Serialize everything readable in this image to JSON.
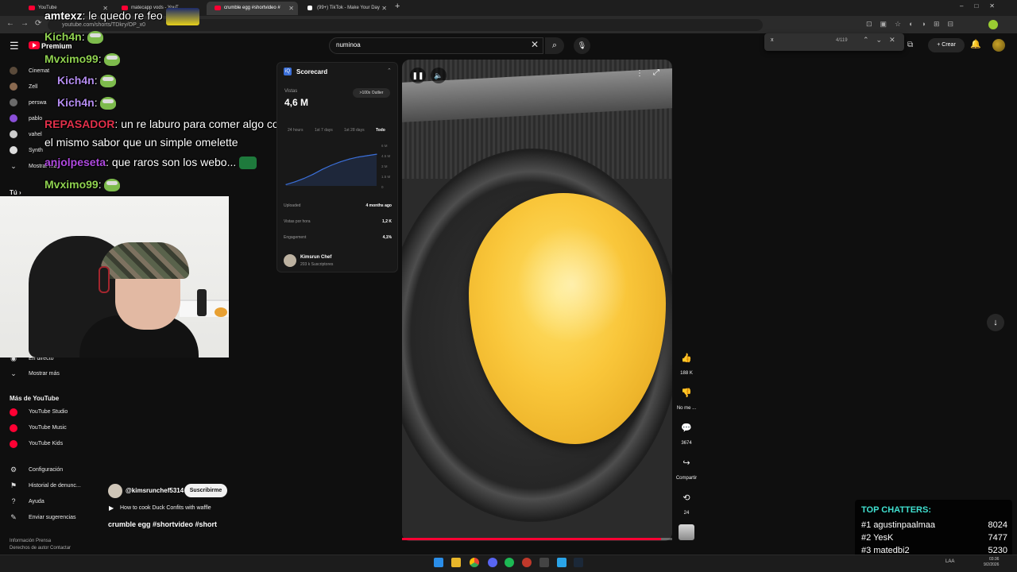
{
  "browser": {
    "tabs": [
      {
        "title": "YouTube",
        "active": false
      },
      {
        "title": "matecapp vods - YouT",
        "active": false
      },
      {
        "title": "crumble egg #shortvideo #",
        "active": true
      },
      {
        "title": "(99+) TikTok - Make Your Day",
        "active": false
      }
    ],
    "url": "youtube.com/shorts/TDkry/OP_x0",
    "find": {
      "query": "x",
      "count": "4/119"
    }
  },
  "header": {
    "logo_text": "Premium",
    "search_value": "numinoa",
    "create_label": "Crear"
  },
  "sidebar": {
    "subscriptions": [
      {
        "label": "Cinemat",
        "color": "#5a4a3a"
      },
      {
        "label": "Zell",
        "color": "#8a6a50"
      },
      {
        "label": "perswa",
        "color": "#6a6a6a"
      },
      {
        "label": "pablo",
        "color": "#8a4fd8"
      },
      {
        "label": "vahel",
        "color": "#cccccc"
      },
      {
        "label": "Synth",
        "color": "#dddddd"
      }
    ],
    "show_more_top": "Mostrar más",
    "you_label": "Tú",
    "live_label": "En directo",
    "show_more": "Mostrar más",
    "more_heading": "Más de YouTube",
    "more_items": [
      {
        "label": "YouTube Studio"
      },
      {
        "label": "YouTube Music"
      },
      {
        "label": "YouTube Kids"
      }
    ],
    "settings_items": [
      {
        "label": "Configuración"
      },
      {
        "label": "Historial de denunc..."
      },
      {
        "label": "Ayuda"
      },
      {
        "label": "Enviar sugerencias"
      }
    ],
    "footer_1": "Información  Prensa",
    "footer_2": "Derechos de autor  Contactar"
  },
  "chat": [
    {
      "name": "amtexz",
      "color": "#ffffff",
      "text": "le quedo re feo",
      "emote": "car"
    },
    {
      "name": "Kich4n",
      "color": "#8fd14f",
      "text": "",
      "emote": "frog"
    },
    {
      "name": "Mvximo99",
      "color": "#8fd14f",
      "text": "",
      "emote": "frog"
    },
    {
      "name": "Kich4n",
      "color": "#b48cf0",
      "text": "",
      "emote": "frog"
    },
    {
      "name": "Kich4n",
      "color": "#b48cf0",
      "text": "",
      "emote": "frog"
    },
    {
      "name": "REPASADOR",
      "color": "#e0304a",
      "text": "un re laburo para comer algo con",
      "emote": ""
    },
    {
      "name": "",
      "color": "#ffffff",
      "text": "el mismo sabor que un simple omelette",
      "emote": ""
    },
    {
      "name": "anjolpeseta",
      "color": "#b04ae0",
      "text": "que raros son los webo...",
      "emote": "green"
    },
    {
      "name": "Mvximo99",
      "color": "#8fd14f",
      "text": "",
      "emote": "frog"
    }
  ],
  "scorecard": {
    "title": "Scorecard",
    "views_label": "Vistas",
    "views": "4,6 M",
    "outlier": ">100x Outlier",
    "ranges": [
      "24 hours",
      "1st 7 days",
      "1st 28 days",
      "Todo"
    ],
    "active_range": "Todo",
    "y_ticks": [
      "6 M",
      "4.5 M",
      "3 M",
      "1.5 M",
      "0"
    ],
    "rows": [
      {
        "label": "Uploaded",
        "value": "4 months ago"
      },
      {
        "label": "Vistas por hora",
        "value": "1,2 K"
      },
      {
        "label": "Engagement",
        "value": "4,1%"
      }
    ],
    "channel_name": "Kimsrun Chef",
    "channel_subs": "203 k Suscriptores"
  },
  "chart_data": {
    "type": "area",
    "x": [
      0,
      1,
      2,
      3,
      4,
      5,
      6,
      7,
      8,
      9,
      10
    ],
    "y": [
      0.2,
      0.6,
      1.1,
      1.7,
      2.4,
      3.0,
      3.5,
      3.9,
      4.2,
      4.4,
      4.6
    ],
    "ylim": [
      0,
      6
    ],
    "y_ticks": [
      "6 M",
      "4.5 M",
      "3 M",
      "1.5 M",
      "0"
    ],
    "grid": false,
    "color": "#3b6fd8"
  },
  "video": {
    "progress": 0.96,
    "likes": "188 K",
    "dislike_label": "No me ...",
    "comments": "3674",
    "share_label": "Compartir",
    "remix_count": "24",
    "channel_handle": "@kimsrunchef5314",
    "subscribe_label": "Suscribirme",
    "related_title": "How to cook Duck Confits with waffle",
    "title": "crumble egg #shortvideo #short"
  },
  "top_chatters": {
    "title": "TOP CHATTERS:",
    "rows": [
      {
        "rank": "#1",
        "name": "agustinpaalmaa",
        "count": "8024"
      },
      {
        "rank": "#2",
        "name": "YesK",
        "count": "7477"
      },
      {
        "rank": "#3",
        "name": "matedbi2",
        "count": "5230"
      }
    ]
  },
  "taskbar": {
    "tray": "LAA",
    "time": "03:36",
    "date": "9/2/2026"
  }
}
